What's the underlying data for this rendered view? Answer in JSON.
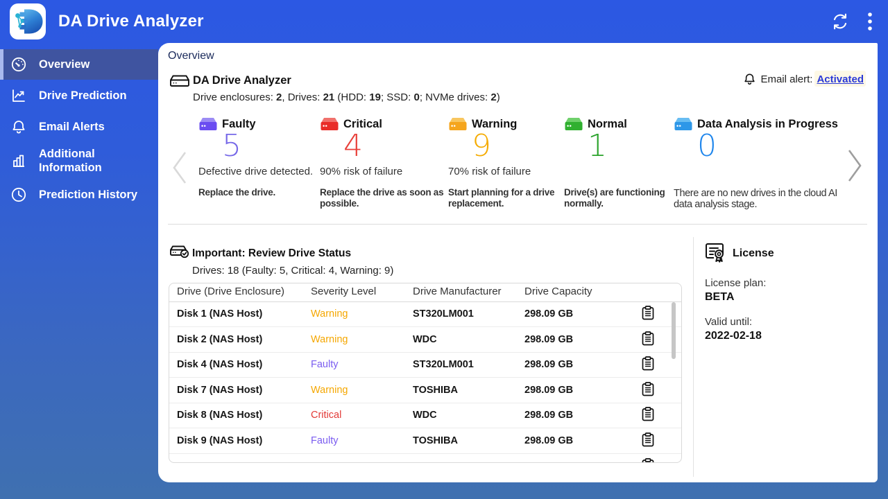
{
  "topbar": {
    "title": "DA Drive Analyzer"
  },
  "sidebar": {
    "items": [
      {
        "label": "Overview",
        "icon": "gauge-icon",
        "active": true
      },
      {
        "label": "Drive Prediction",
        "icon": "line-chart-icon",
        "active": false
      },
      {
        "label": "Email Alerts",
        "icon": "bell-icon",
        "active": false
      },
      {
        "label": "Additional Information",
        "icon": "bar-chart-icon",
        "active": false
      },
      {
        "label": "Prediction History",
        "icon": "clock-icon",
        "active": false
      }
    ]
  },
  "page": {
    "title": "Overview"
  },
  "summary": {
    "heading": "DA Drive Analyzer",
    "sub": {
      "t1": "Drive enclosures: ",
      "v1": "2",
      "t2": ", Drives: ",
      "v2": "21",
      "t3": " (HDD: ",
      "v3": "19",
      "t4": "; SSD: ",
      "v4": "0",
      "t5": "; NVMe drives: ",
      "v5": "2",
      "t6": ")"
    },
    "email_alert": {
      "label": "Email alert: ",
      "status": "Activated"
    }
  },
  "cards": [
    {
      "label": "Faulty",
      "count": "5",
      "count_color": "#7668e8",
      "icon_top": "#9c8bf4",
      "icon_front": "#6a4cf1",
      "line1": "Defective drive detected.",
      "line2": "Replace the drive."
    },
    {
      "label": "Critical",
      "count": "4",
      "count_color": "#e8403a",
      "icon_top": "#f0716c",
      "icon_front": "#e92c28",
      "line1": "90% risk of failure",
      "line2": "Replace the drive as soon as possible."
    },
    {
      "label": "Warning",
      "count": "9",
      "count_color": "#f5ab00",
      "icon_top": "#f8c65f",
      "icon_front": "#f5a51d",
      "line1": "70% risk of failure",
      "line2": "Start planning for a drive replacement."
    },
    {
      "label": "Normal",
      "count": "1",
      "count_color": "#2aa32b",
      "icon_top": "#6fd06b",
      "icon_front": "#30b030",
      "line1": "",
      "line2": "Drive(s) are functioning normally."
    },
    {
      "label": "Data Analysis in Progress",
      "count": "0",
      "count_color": "#1f86ec",
      "icon_top": "#68bdf2",
      "icon_front": "#2d97e8",
      "line1": "",
      "line2": "There are no new drives in the cloud AI data analysis stage."
    }
  ],
  "status_section": {
    "title": "Important: Review Drive Status",
    "subtitle": "Drives: 18 (Faulty: 5, Critical: 4, Warning: 9)",
    "table": {
      "headers": [
        "Drive (Drive Enclosure)",
        "Severity Level",
        "Drive Manufacturer",
        "Drive Capacity"
      ],
      "rows": [
        {
          "drive": "Disk 1 (NAS Host)",
          "severity": "Warning",
          "severity_color": "#f5a700",
          "manufacturer": "ST320LM001",
          "capacity": "298.09 GB"
        },
        {
          "drive": "Disk 2 (NAS Host)",
          "severity": "Warning",
          "severity_color": "#f5a700",
          "manufacturer": "WDC",
          "capacity": "298.09 GB"
        },
        {
          "drive": "Disk 4 (NAS Host)",
          "severity": "Faulty",
          "severity_color": "#7a5cf0",
          "manufacturer": "ST320LM001",
          "capacity": "298.09 GB"
        },
        {
          "drive": "Disk 7 (NAS Host)",
          "severity": "Warning",
          "severity_color": "#f5a700",
          "manufacturer": "TOSHIBA",
          "capacity": "298.09 GB"
        },
        {
          "drive": "Disk 8 (NAS Host)",
          "severity": "Critical",
          "severity_color": "#e23936",
          "manufacturer": "WDC",
          "capacity": "298.09 GB"
        },
        {
          "drive": "Disk 9 (NAS Host)",
          "severity": "Faulty",
          "severity_color": "#7a5cf0",
          "manufacturer": "TOSHIBA",
          "capacity": "298.09 GB"
        }
      ]
    }
  },
  "license": {
    "title": "License",
    "plan_label": "License plan:",
    "plan_value": "BETA",
    "valid_label": "Valid until:",
    "valid_value": "2022-02-18"
  },
  "colors": {
    "topbar_blue": "#2c58e3",
    "bottom_blue": "#4473ac",
    "active_item": "#3f54a0",
    "link_blue": "#2b3ad7"
  }
}
